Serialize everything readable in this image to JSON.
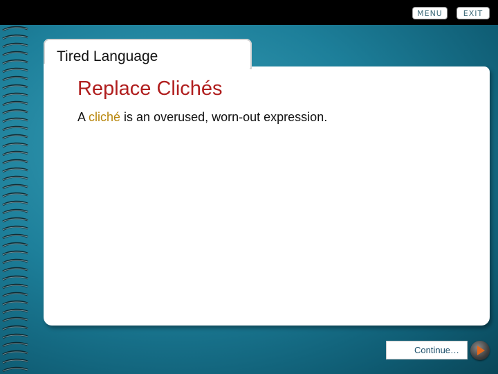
{
  "nav": {
    "menu_label": "MENU",
    "exit_label": "EXIT"
  },
  "slide": {
    "tab_title": "Tired Language",
    "heading": "Replace Clichés",
    "body_prefix": "A ",
    "body_highlight": "cliché",
    "body_suffix": " is an overused, worn-out expression."
  },
  "footer": {
    "continue_label": "Continue…"
  },
  "colors": {
    "heading": "#b01e1e",
    "highlight": "#b8860b",
    "background_accent": "#1d7f9a",
    "play_arrow": "#e2681c"
  },
  "icons": {
    "play": "play-icon",
    "spiral": "spiral-binding"
  }
}
